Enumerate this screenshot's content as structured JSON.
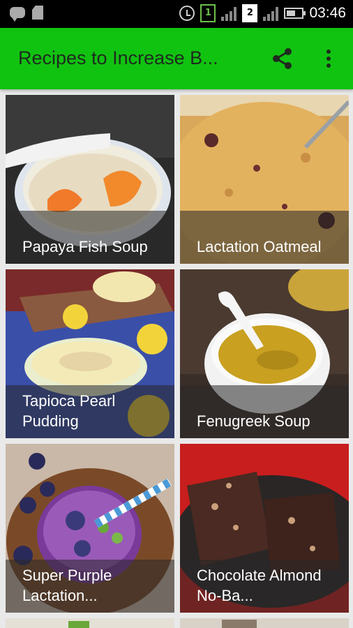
{
  "status_bar": {
    "time": "03:46",
    "sim1": "1",
    "sim2": "2",
    "icons": [
      "message-icon",
      "sdcard-icon",
      "alarm-icon",
      "signal-icon",
      "battery-icon"
    ]
  },
  "app_bar": {
    "title": "Recipes to Increase B...",
    "icons": [
      "share-icon",
      "more-vert-icon"
    ]
  },
  "recipes": [
    {
      "title": "Papaya Fish Soup"
    },
    {
      "title": "Lactation Oatmeal"
    },
    {
      "title": "Tapioca Pearl Pudding"
    },
    {
      "title": "Fenugreek Soup"
    },
    {
      "title": "Super Purple Lactation..."
    },
    {
      "title": "Chocolate Almond No-Ba..."
    }
  ],
  "colors": {
    "app_bar": "#11c311",
    "status_bar": "#000000",
    "caption_overlay": "rgba(40,40,40,0.55)"
  }
}
